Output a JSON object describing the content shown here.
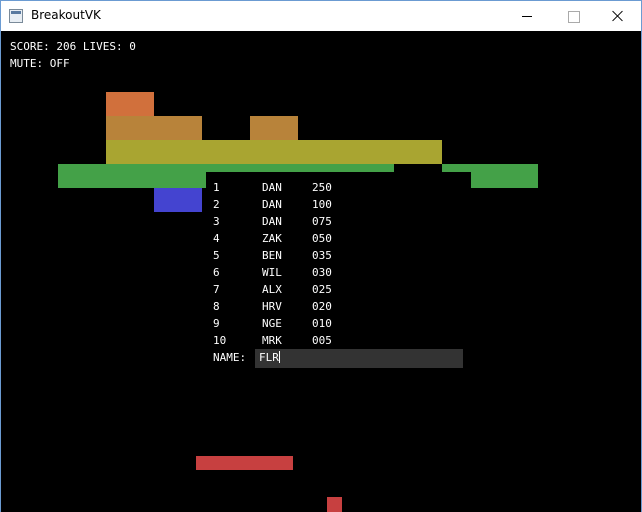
{
  "window": {
    "title": "BreakoutVK"
  },
  "hud": {
    "score_line": "SCORE: 206 LIVES: 0",
    "mute_line": "MUTE: OFF"
  },
  "colors": {
    "orange": "#d1703c",
    "brown": "#b8833a",
    "olive": "#a9a531",
    "green": "#44a148",
    "blue": "#4444d0",
    "red": "#c74040"
  },
  "highscores": [
    {
      "rank": "1",
      "name": "DAN",
      "score": "250"
    },
    {
      "rank": "2",
      "name": "DAN",
      "score": "100"
    },
    {
      "rank": "3",
      "name": "DAN",
      "score": "075"
    },
    {
      "rank": "4",
      "name": "ZAK",
      "score": "050"
    },
    {
      "rank": "5",
      "name": "BEN",
      "score": "035"
    },
    {
      "rank": "6",
      "name": "WIL",
      "score": "030"
    },
    {
      "rank": "7",
      "name": "ALX",
      "score": "025"
    },
    {
      "rank": "8",
      "name": "HRV",
      "score": "020"
    },
    {
      "rank": "9",
      "name": "NGE",
      "score": "010"
    },
    {
      "rank": "10",
      "name": "MRK",
      "score": "005"
    }
  ],
  "name_entry": {
    "label": "NAME:",
    "value": "FLR"
  }
}
